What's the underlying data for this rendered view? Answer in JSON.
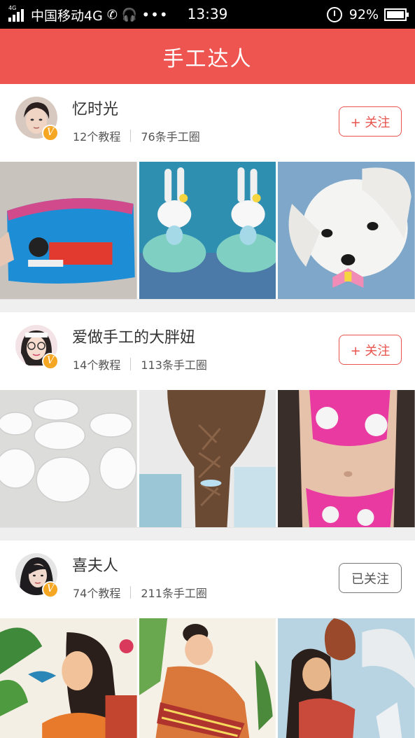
{
  "status_bar": {
    "network_tag": "4G",
    "carrier": "中国移动4G",
    "more": "•••",
    "time": "13:39",
    "battery": "92%"
  },
  "header": {
    "title": "手工达人"
  },
  "creators": [
    {
      "name": "忆时光",
      "tutorials": "12个教程",
      "posts": "76条手工圈",
      "follow_label": "+ 关注",
      "followed": false,
      "badge": "V"
    },
    {
      "name": "爱做手工的大胖妞",
      "tutorials": "14个教程",
      "posts": "113条手工圈",
      "follow_label": "+ 关注",
      "followed": false,
      "badge": "V"
    },
    {
      "name": "喜夫人",
      "tutorials": "74个教程",
      "posts": "211条手工圈",
      "follow_label": "已关注",
      "followed": true,
      "badge": "V"
    }
  ],
  "colors": {
    "accent": "#ef5550",
    "badge": "#f5a623"
  }
}
